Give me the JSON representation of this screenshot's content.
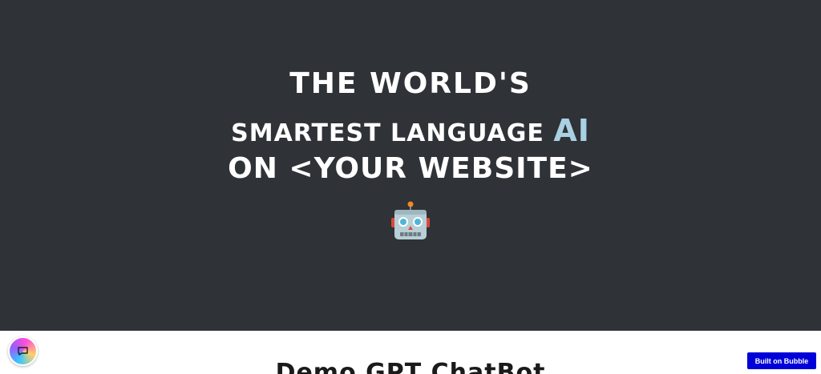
{
  "hero": {
    "line1": "THE WORLD'S",
    "line2_prefix": "SMARTEST LANGUAGE",
    "line2_accent": "AI",
    "line3": "ON <YOUR WEBSITE>",
    "emoji": "robot-icon"
  },
  "section": {
    "title": "Demo GPT ChatBot"
  },
  "badge": {
    "label": "Built on Bubble"
  },
  "colors": {
    "hero_bg": "#2f3237",
    "accent": "#a9d0e3",
    "badge_bg": "#0000d8"
  }
}
